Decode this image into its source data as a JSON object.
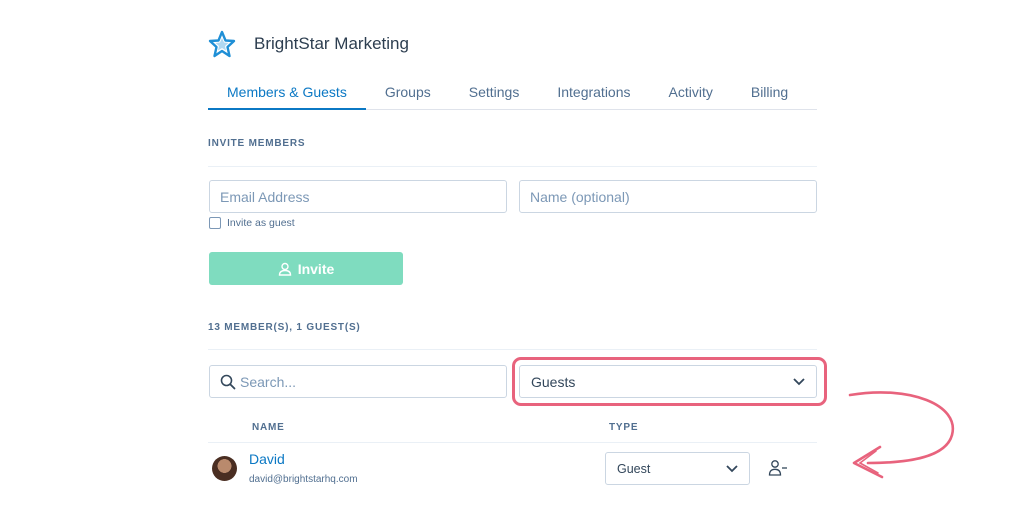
{
  "org": {
    "name": "BrightStar Marketing",
    "logo_icon": "star-icon",
    "accent": "#0b78c4"
  },
  "tabs": [
    {
      "label": "Members & Guests",
      "active": true
    },
    {
      "label": "Groups",
      "active": false
    },
    {
      "label": "Settings",
      "active": false
    },
    {
      "label": "Integrations",
      "active": false
    },
    {
      "label": "Activity",
      "active": false
    },
    {
      "label": "Billing",
      "active": false
    }
  ],
  "invite": {
    "heading": "INVITE MEMBERS",
    "email_placeholder": "Email Address",
    "name_placeholder": "Name (optional)",
    "guest_checkbox_label": "Invite as guest",
    "guest_checked": false,
    "button_label": "Invite",
    "button_color": "#7fdcbf"
  },
  "members": {
    "summary": "13 MEMBER(S), 1 GUEST(S)",
    "search_placeholder": "Search...",
    "filter_value": "Guests",
    "columns": {
      "name": "NAME",
      "type": "TYPE"
    },
    "rows": [
      {
        "name": "David",
        "email": "david@brightstarhq.com",
        "type": "Guest"
      }
    ]
  },
  "annotation": {
    "highlight_color": "#e8637d"
  }
}
